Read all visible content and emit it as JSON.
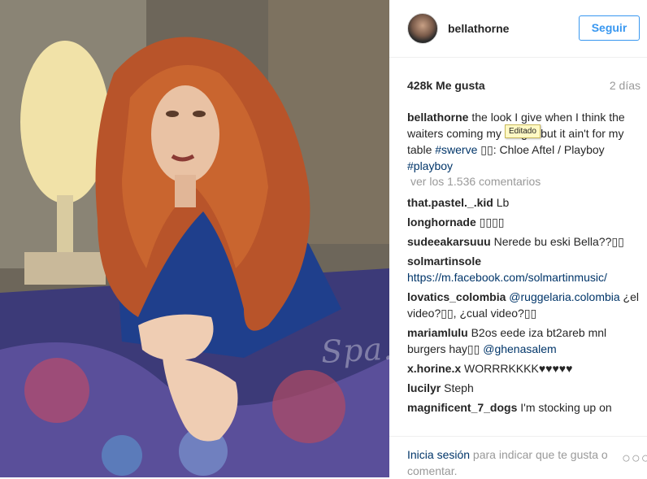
{
  "post": {
    "username": "bellathorne",
    "follow_label": "Seguir",
    "likes": "428k Me gusta",
    "time": "2 días",
    "caption_user": "bellathorne",
    "caption_part1": " the look I give when I think the waiters coming ",
    "caption_part2": " my burger but it ain't for my table ",
    "hashtag1": "#swerve",
    "caption_part3": " ",
    "emoji_box": "▯▯",
    "caption_part4": ": Chloe Aftel / Playboy ",
    "hashtag2": "#playboy",
    "tooltip": "Editado",
    "view_comments": "ver los 1.536 comentarios",
    "watermark": "Spa..."
  },
  "comments": [
    {
      "user": "that.pastel._.kid",
      "text": " Lb"
    },
    {
      "user": "longhornade",
      "text": " ▯▯▯▯"
    },
    {
      "user": "sudeeakarsuuu",
      "text": " Nerede bu eski Bella??▯▯"
    },
    {
      "user": "solmartinsole",
      "text": " https://m.facebook.com/solmartinmusic/"
    },
    {
      "user": "lovatics_colombia",
      "mention": " @ruggelaria.colombia",
      "text": " ¿el video?▯▯, ¿cual video?▯▯"
    },
    {
      "user": "mariamlulu",
      "text": " B2os eede iza bt2areb mnl burgers hay▯▯ ",
      "mention": "@ghenasalem"
    },
    {
      "user": "x.horine.x",
      "text": " WORRRKKKK♥♥♥♥♥"
    },
    {
      "user": "lucilyr",
      "text": " Steph"
    },
    {
      "user": "magnificent_7_dogs",
      "text": " I'm stocking up on"
    }
  ],
  "footer": {
    "login_link": "Inicia sesión",
    "login_text": " para indicar que te gusta o comentar.",
    "more_icon": "ellipsis-icon"
  },
  "colors": {
    "accent": "#3897f0",
    "link": "#003569",
    "muted": "#999999",
    "text": "#262626"
  }
}
